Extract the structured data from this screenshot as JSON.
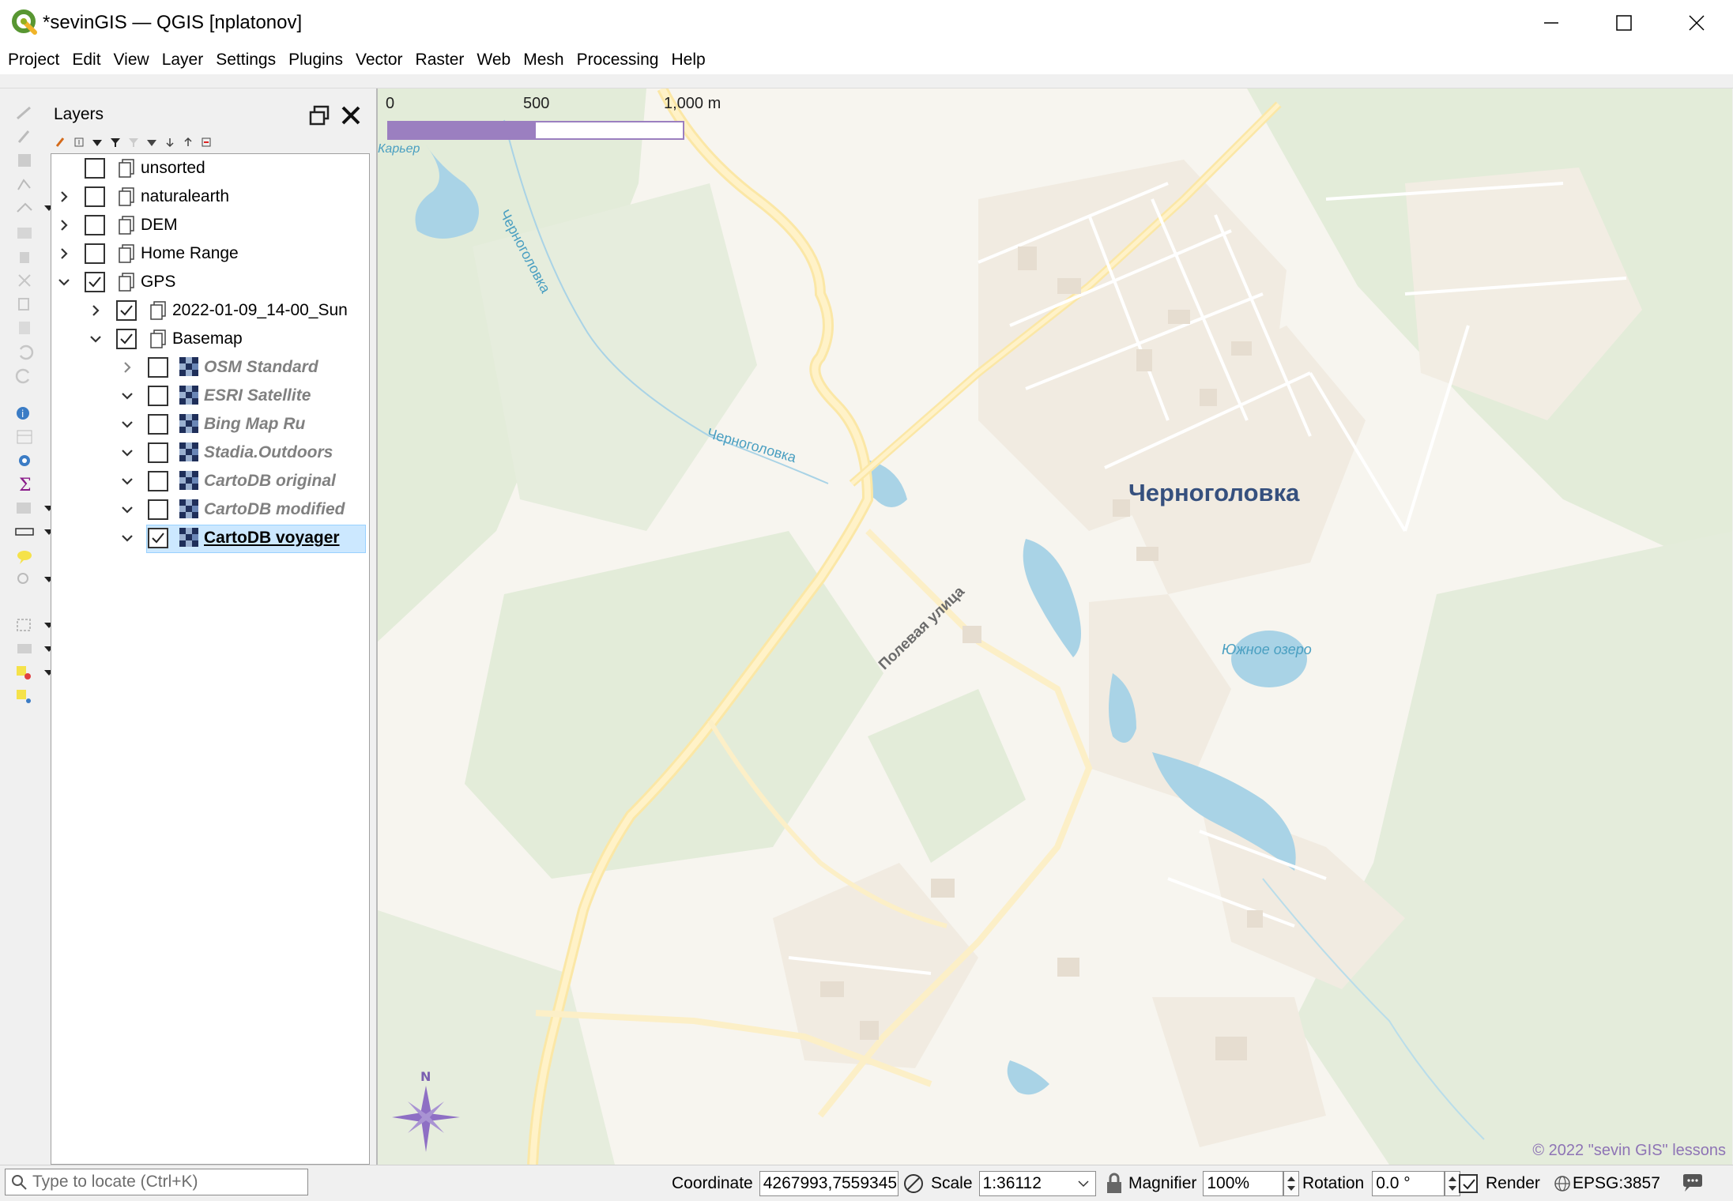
{
  "window": {
    "title": "*sevinGIS — QGIS [nplatonov]"
  },
  "menu": [
    "Project",
    "Edit",
    "View",
    "Layer",
    "Settings",
    "Plugins",
    "Vector",
    "Raster",
    "Web",
    "Mesh",
    "Processing",
    "Help"
  ],
  "layers_panel": {
    "title": "Layers",
    "items": [
      {
        "label": "unsorted",
        "checked": false,
        "kind": "group",
        "expander": "none"
      },
      {
        "label": "naturalearth",
        "checked": false,
        "kind": "group",
        "expander": "collapsed"
      },
      {
        "label": "DEM",
        "checked": false,
        "kind": "group",
        "expander": "collapsed"
      },
      {
        "label": "Home Range",
        "checked": false,
        "kind": "group",
        "expander": "collapsed"
      },
      {
        "label": "GPS",
        "checked": true,
        "kind": "group",
        "expander": "expanded"
      },
      {
        "label": "2022-01-09_14-00_Sun",
        "checked": true,
        "kind": "group",
        "expander": "collapsed"
      },
      {
        "label": "Basemap",
        "checked": true,
        "kind": "group",
        "expander": "expanded"
      },
      {
        "label": "OSM Standard",
        "checked": false,
        "kind": "raster",
        "expander": "collapsed"
      },
      {
        "label": "ESRI Satellite",
        "checked": false,
        "kind": "raster",
        "expander": "expanded"
      },
      {
        "label": "Bing Map Ru",
        "checked": false,
        "kind": "raster",
        "expander": "expanded"
      },
      {
        "label": "Stadia.Outdoors",
        "checked": false,
        "kind": "raster",
        "expander": "expanded"
      },
      {
        "label": "CartoDB original",
        "checked": false,
        "kind": "raster",
        "expander": "expanded"
      },
      {
        "label": "CartoDB modified",
        "checked": false,
        "kind": "raster",
        "expander": "expanded"
      },
      {
        "label": "CartoDB voyager",
        "checked": true,
        "kind": "raster",
        "expander": "expanded",
        "selected": true
      }
    ]
  },
  "map": {
    "scalebar": {
      "ticks": [
        "0",
        "500",
        "1,000 m"
      ],
      "fill_fraction": 0.5,
      "color": "#9b7fc0"
    },
    "labels": {
      "city": "Черноголовка",
      "river_1": "Черноголовка",
      "river_2": "Черноголовка",
      "street": "Полевая улица",
      "lake": "Южное озеро",
      "quarry": "Карьер"
    },
    "north_label": "N",
    "attribution": "© 2022 \"sevin GIS\" lessons"
  },
  "statusbar": {
    "locator_placeholder": "Type to locate (Ctrl+K)",
    "coordinate_label": "Coordinate",
    "coordinate_value": "4267993,7559345",
    "scale_label": "Scale",
    "scale_value": "1:36112",
    "magnifier_label": "Magnifier",
    "magnifier_value": "100%",
    "rotation_label": "Rotation",
    "rotation_value": "0.0 °",
    "render_label": "Render",
    "render_checked": true,
    "crs": "EPSG:3857"
  },
  "colors": {
    "map_background": "#f7f5ef",
    "forest": "#e3ecd9",
    "water": "#a9d3e6",
    "road_major": "#fbe7a6",
    "residential": "#f1ebe1",
    "selection": "#cce8ff",
    "accent": "#9b7fc0"
  }
}
